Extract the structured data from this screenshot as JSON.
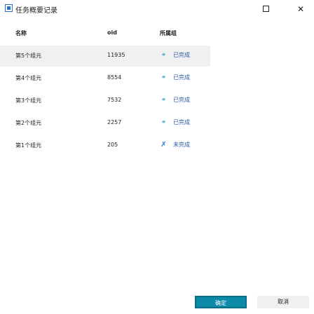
{
  "window": {
    "title": "任务概要记录",
    "icon": "app-window-icon",
    "maximize_icon": "maximize-icon",
    "close_label": "✕"
  },
  "table": {
    "headers": {
      "name": "名称",
      "oid": "oid",
      "status": "所属组"
    },
    "rows": [
      {
        "name": "第5个组元",
        "oid": "11935",
        "status": "已完成",
        "status_icon": "linked-nodes-icon",
        "selected": true
      },
      {
        "name": "第4个组元",
        "oid": "8554",
        "status": "已完成",
        "status_icon": "linked-nodes-icon",
        "selected": false
      },
      {
        "name": "第3个组元",
        "oid": "7532",
        "status": "已完成",
        "status_icon": "linked-nodes-icon",
        "selected": false
      },
      {
        "name": "第2个组元",
        "oid": "2257",
        "status": "已完成",
        "status_icon": "linked-nodes-icon",
        "selected": false
      },
      {
        "name": "第1个组元",
        "oid": "205",
        "status": "未完成",
        "status_icon": "x-mark-icon",
        "selected": false
      }
    ]
  },
  "buttons": {
    "ok": "确定",
    "cancel": "取消"
  },
  "colors": {
    "accent": "#0d8aa8",
    "status_text": "#2a5ca8",
    "selected_row": "#f0f0f0"
  }
}
